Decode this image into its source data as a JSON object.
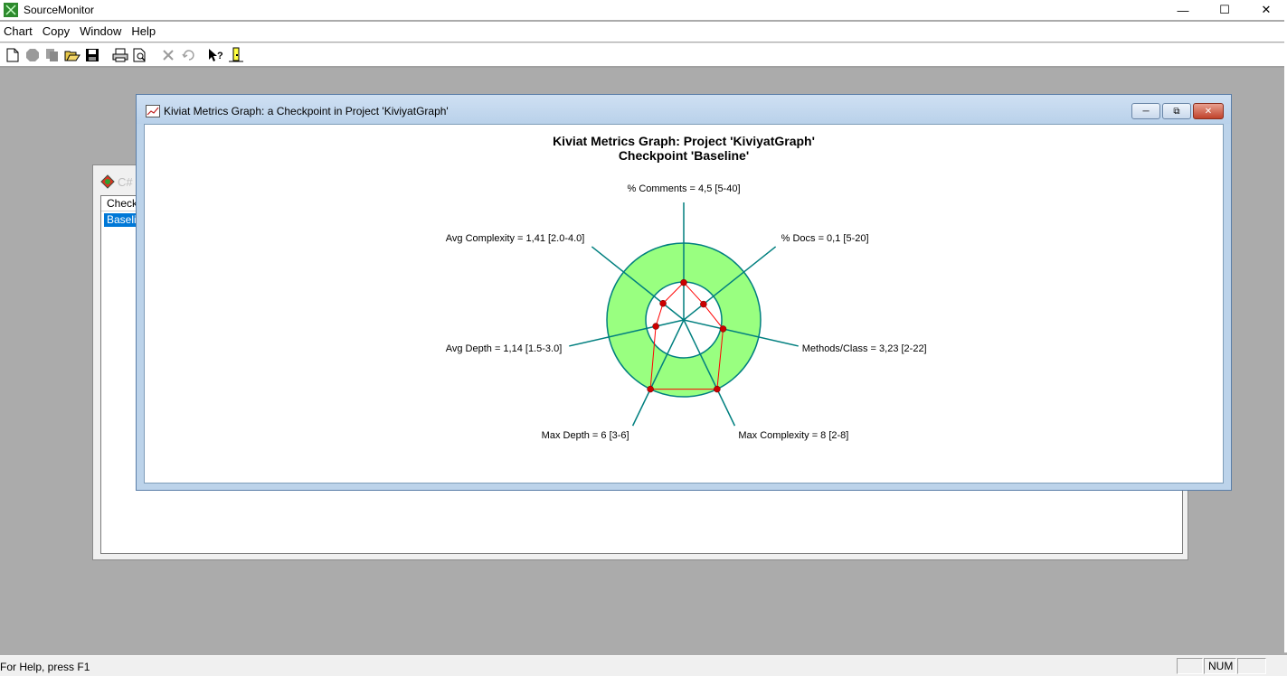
{
  "app": {
    "title": "SourceMonitor"
  },
  "menu": [
    "Chart",
    "Copy",
    "Window",
    "Help"
  ],
  "toolbar": {
    "buttons": [
      "new-file-icon",
      "stop-icon",
      "copy-icon",
      "open-folder-icon",
      "save-icon",
      "print-icon",
      "print-preview-icon",
      "delete-icon",
      "undo-icon",
      "context-help-icon",
      "exit-icon"
    ]
  },
  "child_back": {
    "title": "C#",
    "list_header": "Checkp",
    "selected_row": "Baselin"
  },
  "kiviat_window": {
    "title": "Kiviat Metrics Graph: a Checkpoint in Project 'KiviyatGraph'"
  },
  "chart_data": {
    "type": "kiviat",
    "title": "Kiviat Metrics Graph: Project 'KiviyatGraph'",
    "subtitle": "Checkpoint 'Baseline'",
    "axes": [
      {
        "label": "% Comments = 4,5 [5-40]",
        "value": 4.5,
        "range": [
          5,
          40
        ]
      },
      {
        "label": "% Docs = 0,1 [5-20]",
        "value": 0.1,
        "range": [
          5,
          20
        ]
      },
      {
        "label": "Methods/Class = 3,23 [2-22]",
        "value": 3.23,
        "range": [
          2,
          22
        ]
      },
      {
        "label": "Max Complexity = 8 [2-8]",
        "value": 8,
        "range": [
          2,
          8
        ]
      },
      {
        "label": "Max Depth = 6 [3-6]",
        "value": 6,
        "range": [
          3,
          6
        ]
      },
      {
        "label": "Avg Depth = 1,14 [1.5-3.0]",
        "value": 1.14,
        "range": [
          1.5,
          3.0
        ]
      },
      {
        "label": "Avg Complexity = 1,41 [2.0-4.0]",
        "value": 1.41,
        "range": [
          2.0,
          4.0
        ]
      }
    ],
    "colors": {
      "band": "#99ff80",
      "axis": "#007f7f",
      "polygon": "#ff0000",
      "point": "#cc0000"
    }
  },
  "statusbar": {
    "help_text": "For Help, press F1",
    "num": "NUM"
  }
}
